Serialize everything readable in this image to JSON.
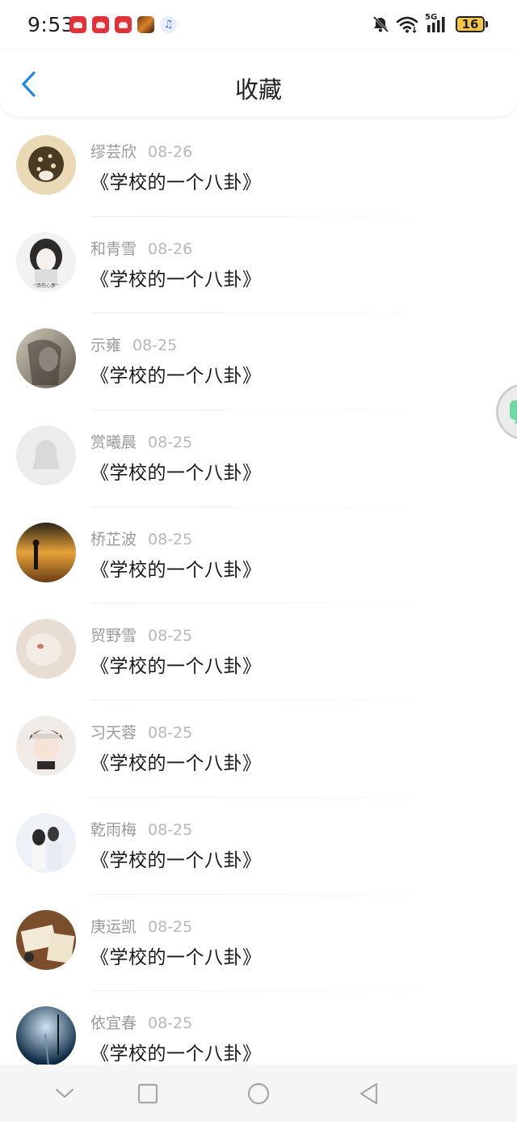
{
  "status_bar": {
    "time": "9:53",
    "network": "5G",
    "battery": "16",
    "notification_icons": [
      "huawei-app-icon",
      "huawei-app-icon",
      "huawei-app-icon",
      "game-app-icon",
      "music-app-icon"
    ]
  },
  "header": {
    "title": "收藏",
    "back_icon": "chevron-left-icon"
  },
  "colors": {
    "accent": "#1e88e5",
    "battery_fill": "#f4c64a",
    "notification_red": "#e3313a"
  },
  "favorites": [
    {
      "name": "缪芸欣",
      "date": "08-26",
      "title": "《学校的一个八卦》",
      "avatar": "cookie-avatar"
    },
    {
      "name": "和青雪",
      "date": "08-26",
      "title": "《学校的一个八卦》",
      "avatar": "girl-sketch-avatar",
      "avatar_caption": "·°南伤心夢°·"
    },
    {
      "name": "示雍",
      "date": "08-25",
      "title": "《学校的一个八卦》",
      "avatar": "girl-photo-avatar"
    },
    {
      "name": "赏曦晨",
      "date": "08-25",
      "title": "《学校的一个八卦》",
      "avatar": "default-avatar"
    },
    {
      "name": "桥芷波",
      "date": "08-25",
      "title": "《学校的一个八卦》",
      "avatar": "sunset-avatar"
    },
    {
      "name": "贸野雪",
      "date": "08-25",
      "title": "《学校的一个八卦》",
      "avatar": "pet-avatar"
    },
    {
      "name": "习天蓉",
      "date": "08-25",
      "title": "《学校的一个八卦》",
      "avatar": "anime-boy-avatar"
    },
    {
      "name": "乾雨梅",
      "date": "08-25",
      "title": "《学校的一个八卦》",
      "avatar": "couple-avatar"
    },
    {
      "name": "庚运凯",
      "date": "08-25",
      "title": "《学校的一个八卦》",
      "avatar": "thank-you-card-avatar"
    },
    {
      "name": "依宜春",
      "date": "08-25",
      "title": "《学校的一个八卦》",
      "avatar": "blue-road-avatar"
    }
  ],
  "floating_button": {
    "icon": "chat-bubble-icon"
  },
  "nav_bar": {
    "buttons": [
      "chevron-down-icon",
      "square-icon",
      "circle-icon",
      "triangle-back-icon"
    ]
  }
}
